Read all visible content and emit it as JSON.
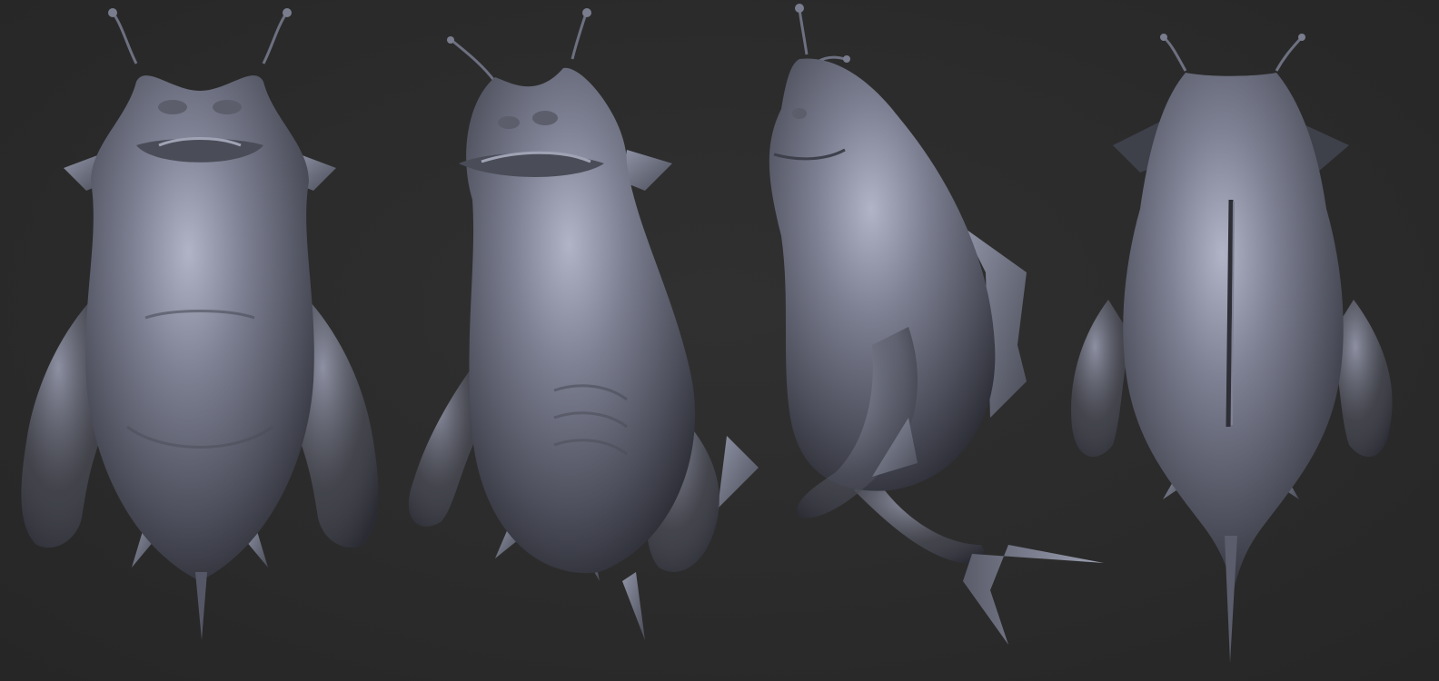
{
  "scene": {
    "background_color": "#2b2b2b",
    "material_color": "#6e7080",
    "highlight_color": "#a8acbd",
    "shadow_color": "#23242b",
    "views": [
      {
        "name": "front"
      },
      {
        "name": "three-quarter"
      },
      {
        "name": "side"
      },
      {
        "name": "back"
      }
    ]
  }
}
